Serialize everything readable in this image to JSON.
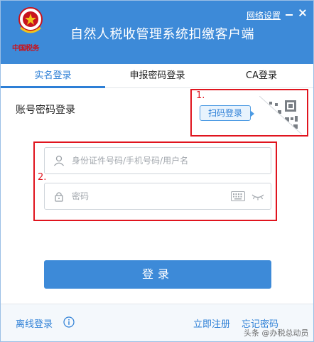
{
  "header": {
    "emblem_text": "中国税务",
    "app_title": "自然人税收管理系统扣缴客户端",
    "network_settings": "网络设置",
    "minimize_icon": "minimize-icon",
    "close_icon": "close-icon",
    "background_color": "#3d8ad8"
  },
  "tabs": [
    {
      "label": "实名登录",
      "active": true
    },
    {
      "label": "申报密码登录",
      "active": false
    },
    {
      "label": "CA登录",
      "active": false
    }
  ],
  "login": {
    "section_title": "账号密码登录",
    "scan_button_label": "扫码登录",
    "qr_icon": "qr-code-icon",
    "username_placeholder": "身份证件号码/手机号码/用户名",
    "password_placeholder": "密码",
    "username_value": "",
    "password_value": "",
    "user_icon": "user-icon",
    "lock_icon": "lock-icon",
    "keyboard_icon": "keyboard-icon",
    "eye_icon": "eye-closed-icon",
    "submit_label": "登录"
  },
  "annotations": {
    "marker_1": "1.",
    "marker_2": "2.",
    "color": "#e0141e"
  },
  "footer": {
    "offline_login": "离线登录",
    "info_icon": "info-icon",
    "register": "立即注册",
    "forgot_password": "忘记密码",
    "watermark": "头条 @办税总动员"
  },
  "colors": {
    "accent": "#2d7fd6",
    "primary_button": "#3d8ad8"
  }
}
